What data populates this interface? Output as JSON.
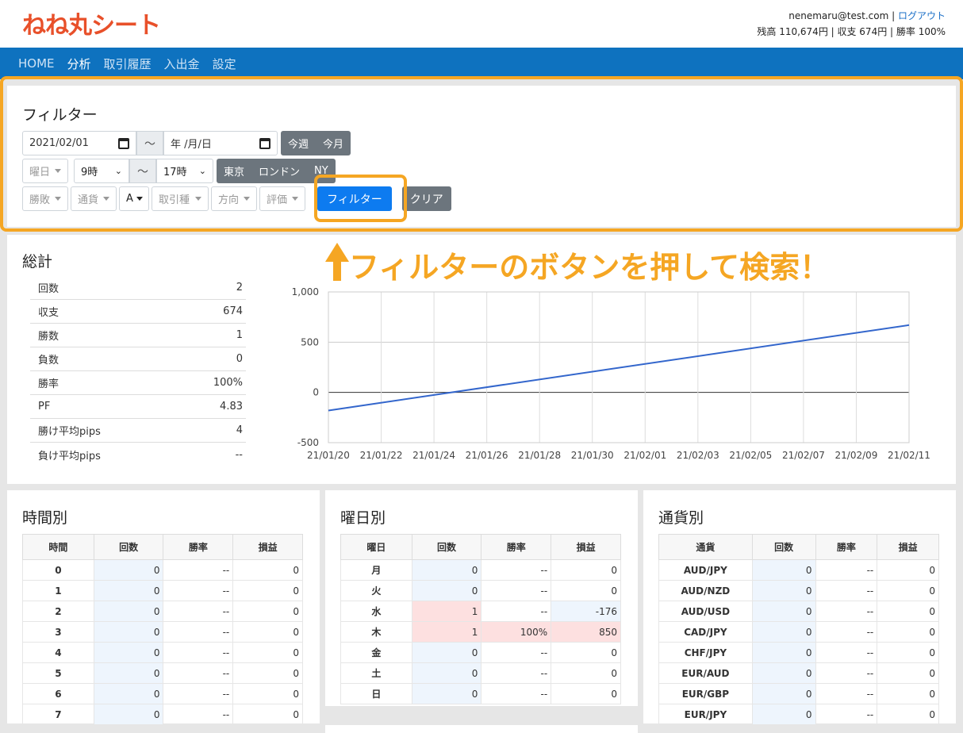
{
  "header": {
    "logo": "ねね丸シート",
    "email": "nenemaru@test.com",
    "logout": "ログアウト",
    "balance_line": "残高 110,674円 | 収支 674円 | 勝率 100%"
  },
  "nav": [
    "HOME",
    "分析",
    "取引履歴",
    "入出金",
    "設定"
  ],
  "filter": {
    "title": "フィルター",
    "date_from": "2021/02/01",
    "tilde": "～",
    "date_to": "年 /月/日",
    "quick": [
      "今週",
      "今月"
    ],
    "weekday": "曜日",
    "hour_from": "9時",
    "hour_to": "17時",
    "sessions": [
      "東京",
      "ロンドン",
      "NY"
    ],
    "dropdowns": [
      "勝敗",
      "通貨",
      "A",
      "取引種",
      "方向",
      "評価"
    ],
    "filter_button": "フィルター",
    "clear_button": "クリア"
  },
  "annotation": "フィルターのボタンを押して検索！",
  "summary": {
    "title": "総計",
    "stats": [
      {
        "label": "回数",
        "value": "2"
      },
      {
        "label": "収支",
        "value": "674"
      },
      {
        "label": "勝数",
        "value": "1"
      },
      {
        "label": "負数",
        "value": "0"
      },
      {
        "label": "勝率",
        "value": "100%"
      },
      {
        "label": "PF",
        "value": "4.83"
      },
      {
        "label": "勝け平均pips",
        "value": "4"
      },
      {
        "label": "負け平均pips",
        "value": "--"
      }
    ]
  },
  "chart_data": {
    "type": "line",
    "x": [
      "21/01/20",
      "21/02/11"
    ],
    "series": [
      {
        "values": [
          -180,
          670
        ]
      }
    ],
    "x_ticks": [
      "21/01/20",
      "21/01/22",
      "21/01/24",
      "21/01/26",
      "21/01/28",
      "21/01/30",
      "21/02/01",
      "21/02/03",
      "21/02/05",
      "21/02/07",
      "21/02/09",
      "21/02/11"
    ],
    "y_ticks": [
      "1,000",
      "500",
      "0",
      "-500"
    ],
    "ylim": [
      -500,
      1000
    ],
    "grid": true,
    "color": "#3366cc"
  },
  "time_table": {
    "title": "時間別",
    "headers": [
      "時間",
      "回数",
      "勝率",
      "損益"
    ],
    "rows": [
      [
        "0",
        "0",
        "--",
        "0"
      ],
      [
        "1",
        "0",
        "--",
        "0"
      ],
      [
        "2",
        "0",
        "--",
        "0"
      ],
      [
        "3",
        "0",
        "--",
        "0"
      ],
      [
        "4",
        "0",
        "--",
        "0"
      ],
      [
        "5",
        "0",
        "--",
        "0"
      ],
      [
        "6",
        "0",
        "--",
        "0"
      ],
      [
        "7",
        "0",
        "--",
        "0"
      ]
    ]
  },
  "weekday_table": {
    "title": "曜日別",
    "headers": [
      "曜日",
      "回数",
      "勝率",
      "損益"
    ],
    "rows": [
      [
        "月",
        "0",
        "--",
        "0"
      ],
      [
        "火",
        "0",
        "--",
        "0"
      ],
      [
        "水",
        "1",
        "--",
        "-176"
      ],
      [
        "木",
        "1",
        "100%",
        "850"
      ],
      [
        "金",
        "0",
        "--",
        "0"
      ],
      [
        "土",
        "0",
        "--",
        "0"
      ],
      [
        "日",
        "0",
        "--",
        "0"
      ]
    ]
  },
  "currency_table": {
    "title": "通貨別",
    "headers": [
      "通貨",
      "回数",
      "勝率",
      "損益"
    ],
    "rows": [
      [
        "AUD/JPY",
        "0",
        "--",
        "0"
      ],
      [
        "AUD/NZD",
        "0",
        "--",
        "0"
      ],
      [
        "AUD/USD",
        "0",
        "--",
        "0"
      ],
      [
        "CAD/JPY",
        "0",
        "--",
        "0"
      ],
      [
        "CHF/JPY",
        "0",
        "--",
        "0"
      ],
      [
        "EUR/AUD",
        "0",
        "--",
        "0"
      ],
      [
        "EUR/GBP",
        "0",
        "--",
        "0"
      ],
      [
        "EUR/JPY",
        "0",
        "--",
        "0"
      ]
    ]
  },
  "colors": {
    "accent": "#f5a623",
    "nav": "#0e72bf",
    "primary": "#0d7bf0"
  }
}
